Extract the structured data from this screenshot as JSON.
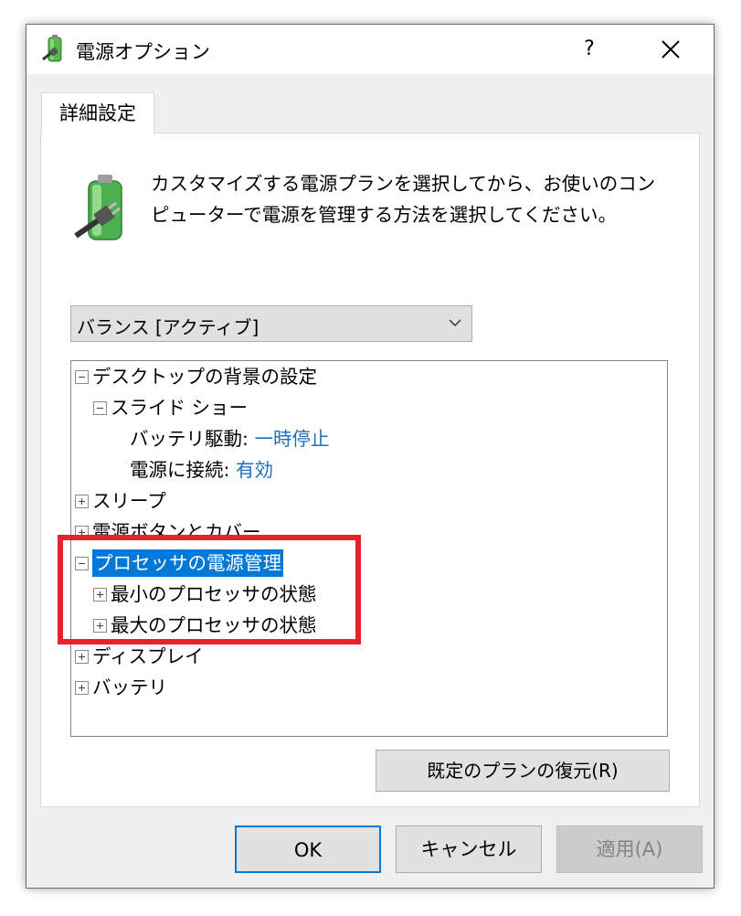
{
  "window": {
    "title": "電源オプション",
    "help": "?",
    "close_icon": "close-icon"
  },
  "tab": {
    "label": "詳細設定"
  },
  "description": "カスタマイズする電源プランを選択してから、お使いのコンピューターで電源を管理する方法を選択してください。",
  "plan_select": {
    "selected": "バランス [アクティブ]"
  },
  "tree": {
    "desktop_bg": "デスクトップの背景の設定",
    "slideshow": "スライド ショー",
    "on_battery_label": "バッテリ駆動:",
    "on_battery_value": "一時停止",
    "plugged_in_label": "電源に接続:",
    "plugged_in_value": "有効",
    "sleep": "スリープ",
    "power_buttons": "電源ボタンとカバー",
    "processor_power": "プロセッサの電源管理",
    "min_processor": "最小のプロセッサの状態",
    "max_processor": "最大のプロセッサの状態",
    "display": "ディスプレイ",
    "battery": "バッテリ"
  },
  "restore_button": "既定のプランの復元(R)",
  "buttons": {
    "ok": "OK",
    "cancel": "キャンセル",
    "apply": "適用(A)"
  },
  "colors": {
    "selection": "#0078d7",
    "highlight_box": "#e8222b",
    "value_link": "#1f6dbb"
  }
}
